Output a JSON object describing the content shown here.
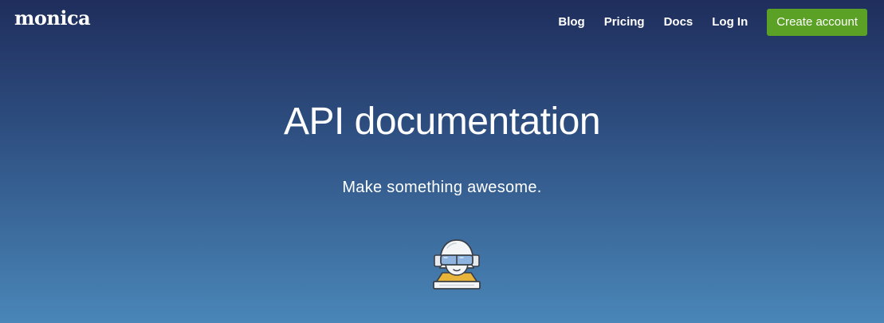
{
  "header": {
    "logo_text": "monica",
    "nav": [
      {
        "label": "Blog"
      },
      {
        "label": "Pricing"
      },
      {
        "label": "Docs"
      },
      {
        "label": "Log In"
      }
    ],
    "cta_label": "Create account"
  },
  "hero": {
    "title": "API documentation",
    "subtitle": "Make something awesome.",
    "illustration": "astronaut-with-goggles-icon"
  },
  "colors": {
    "gradient_top": "#1f2e5c",
    "gradient_bottom": "#4a86b8",
    "cta_green": "#5aa125",
    "text": "#ffffff"
  }
}
